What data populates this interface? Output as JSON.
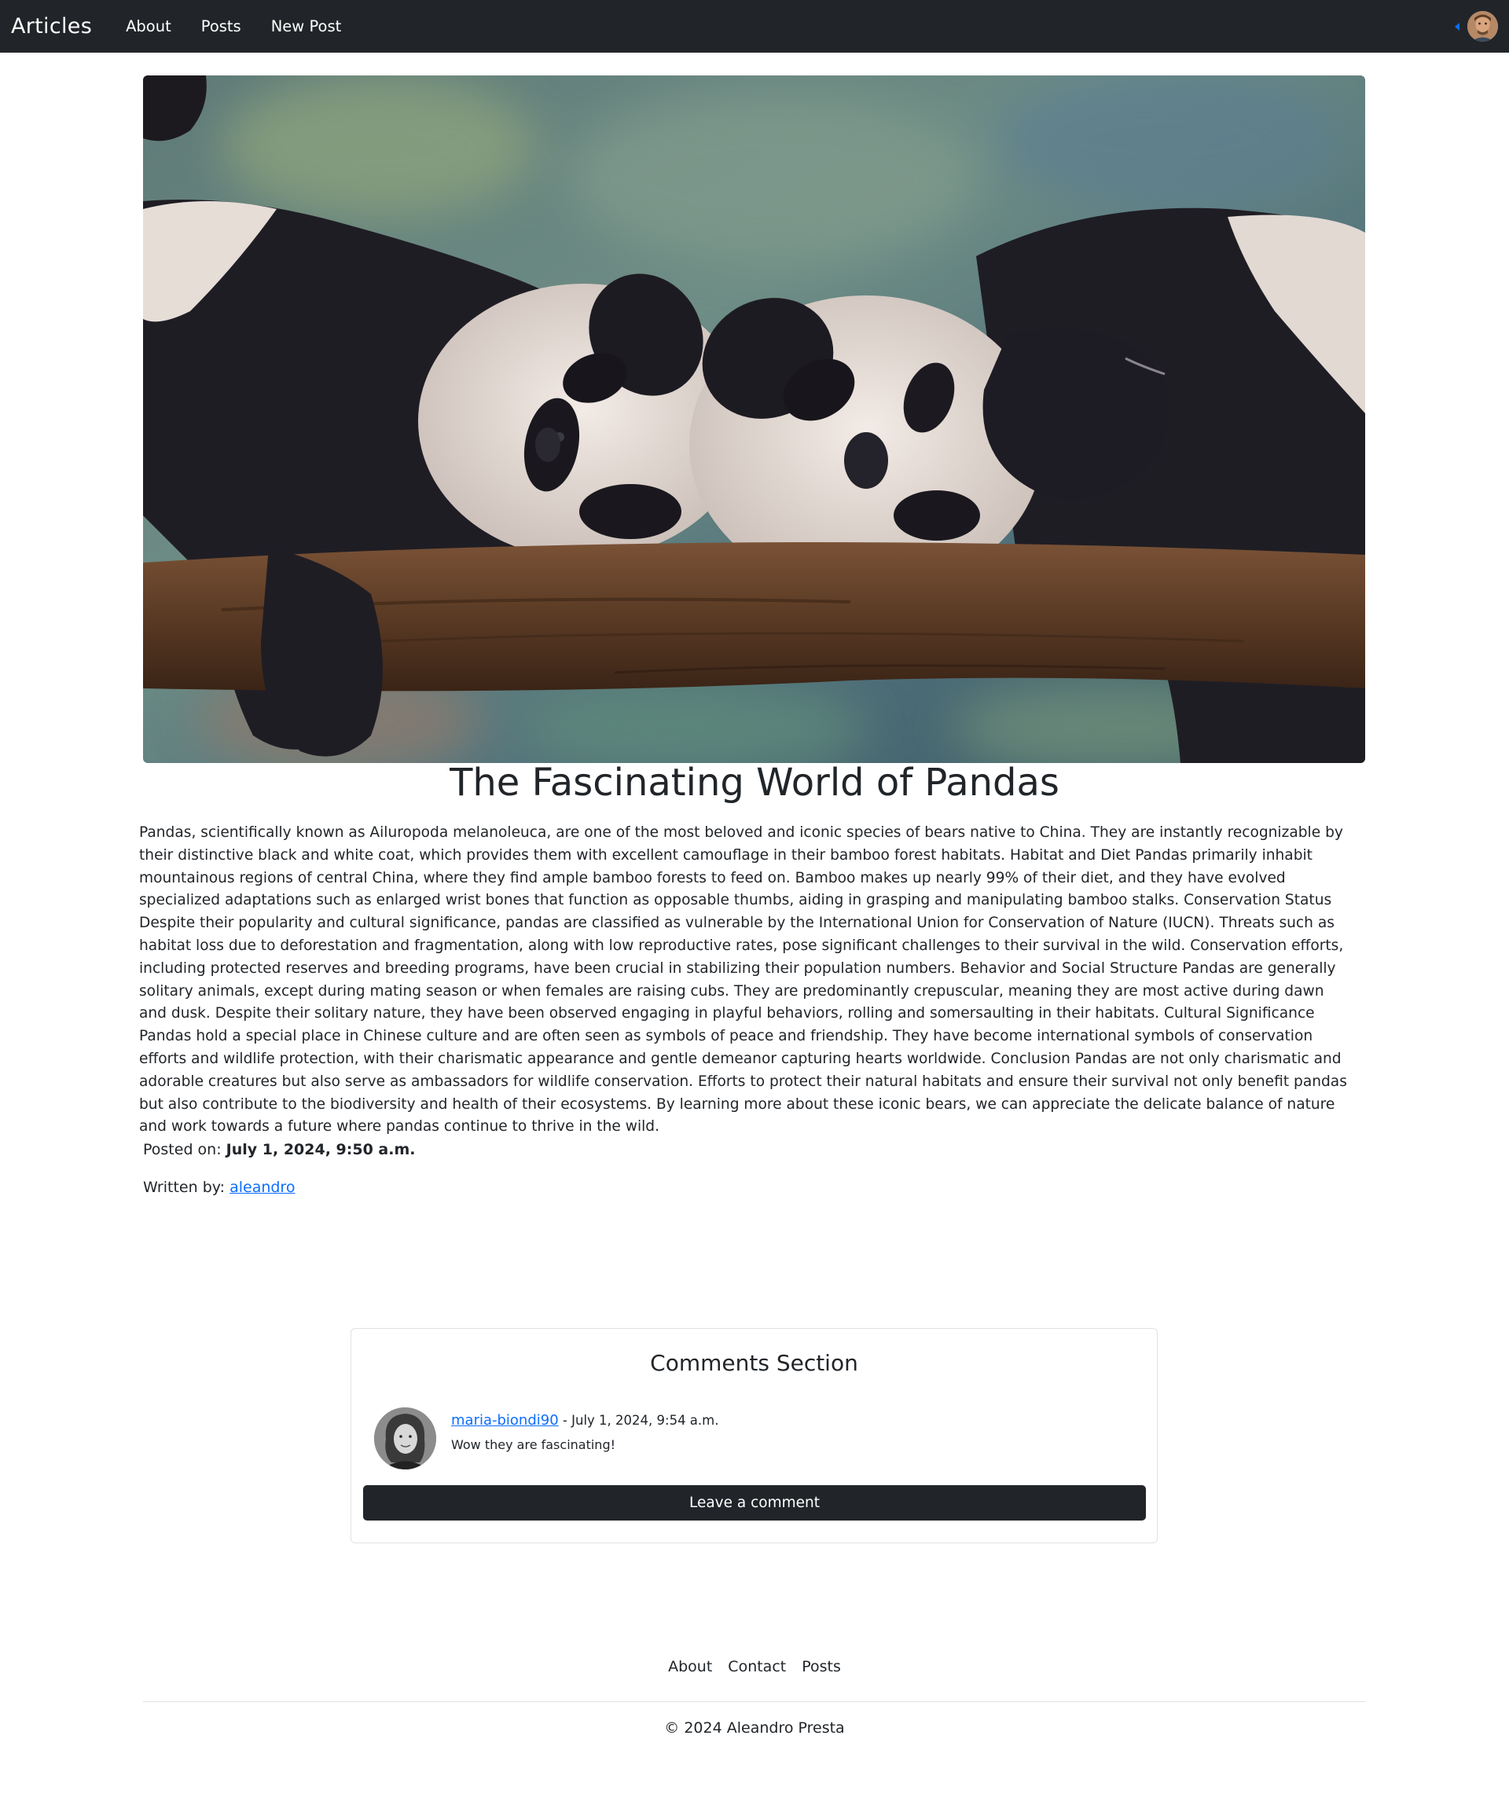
{
  "navbar": {
    "brand": "Articles",
    "links": [
      "About",
      "Posts",
      "New Post"
    ]
  },
  "article": {
    "hero_image_alt": "Two pandas resting on a log",
    "title": "The Fascinating World of Pandas",
    "body": "Pandas, scientifically known as Ailuropoda melanoleuca, are one of the most beloved and iconic species of bears native to China. They are instantly recognizable by their distinctive black and white coat, which provides them with excellent camouflage in their bamboo forest habitats. Habitat and Diet Pandas primarily inhabit mountainous regions of central China, where they find ample bamboo forests to feed on. Bamboo makes up nearly 99% of their diet, and they have evolved specialized adaptations such as enlarged wrist bones that function as opposable thumbs, aiding in grasping and manipulating bamboo stalks. Conservation Status Despite their popularity and cultural significance, pandas are classified as vulnerable by the International Union for Conservation of Nature (IUCN). Threats such as habitat loss due to deforestation and fragmentation, along with low reproductive rates, pose significant challenges to their survival in the wild. Conservation efforts, including protected reserves and breeding programs, have been crucial in stabilizing their population numbers. Behavior and Social Structure Pandas are generally solitary animals, except during mating season or when females are raising cubs. They are predominantly crepuscular, meaning they are most active during dawn and dusk. Despite their solitary nature, they have been observed engaging in playful behaviors, rolling and somersaulting in their habitats. Cultural Significance Pandas hold a special place in Chinese culture and are often seen as symbols of peace and friendship. They have become international symbols of conservation efforts and wildlife protection, with their charismatic appearance and gentle demeanor capturing hearts worldwide. Conclusion Pandas are not only charismatic and adorable creatures but also serve as ambassadors for wildlife conservation. Efforts to protect their natural habitats and ensure their survival not only benefit pandas but also contribute to the biodiversity and health of their ecosystems. By learning more about these iconic bears, we can appreciate the delicate balance of nature and work towards a future where pandas continue to thrive in the wild.",
    "posted_label": "Posted on:",
    "posted_date": "July 1, 2024, 9:50 a.m.",
    "written_label": "Written by:",
    "author": "aleandro"
  },
  "comments": {
    "title": "Comments Section",
    "items": [
      {
        "user": "maria-biondi90",
        "separator": " - ",
        "date": "July 1, 2024, 9:54 a.m.",
        "text": "Wow they are fascinating!"
      }
    ],
    "leave_button": "Leave a comment"
  },
  "footer": {
    "links": [
      "About",
      "Contact",
      "Posts"
    ],
    "copyright": "© 2024 Aleandro Presta"
  },
  "colors": {
    "navbar_bg": "#212529",
    "link": "#0d6efd",
    "button_bg": "#212529"
  }
}
